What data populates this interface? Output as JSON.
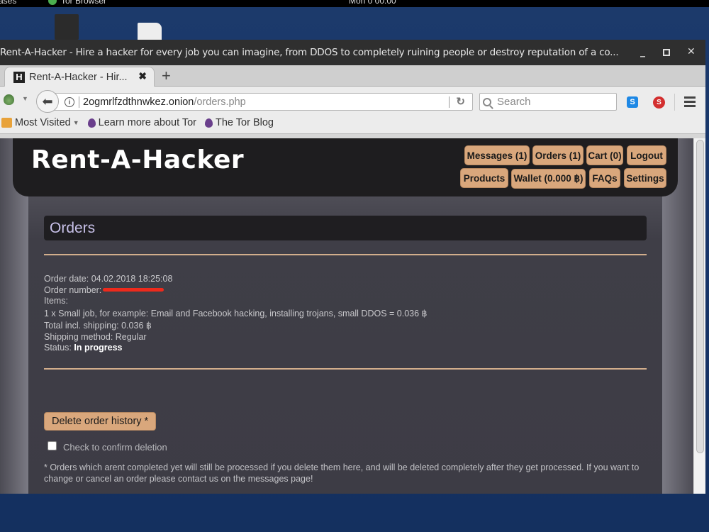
{
  "system_bar": {
    "left_text": "ases",
    "app_label": "Tor Browser",
    "clock": "Mon 0 00:00"
  },
  "window": {
    "title": "Rent-A-Hacker - Hire a hacker for every job you can imagine, from DDOS to completely ruining people or destroy reputation of a co...",
    "minimize_icon": "_",
    "close_icon": "✕"
  },
  "tabs": [
    {
      "favicon": "H",
      "label": "Rent-A-Hacker - Hir...",
      "close": "✖"
    }
  ],
  "new_tab": "+",
  "nav": {
    "back_icon": "⬅",
    "url_host": "2ogmrlfzdthnwkez.onion",
    "url_path": "/orders.php",
    "reload_icon": "↻",
    "search_placeholder": "Search",
    "ext_s_label": "S",
    "ext_noscript_label": "S"
  },
  "bookmarks": [
    {
      "label": "Most Visited",
      "type": "folder"
    },
    {
      "label": "Learn more about Tor",
      "type": "tor"
    },
    {
      "label": "The Tor Blog",
      "type": "tor"
    }
  ],
  "site": {
    "logo": "Rent-A-Hacker",
    "nav_buttons": [
      {
        "label": "Messages (1)"
      },
      {
        "label": "Orders (1)"
      },
      {
        "label": "Cart (0)"
      },
      {
        "label": "Logout"
      },
      {
        "label": "Products"
      },
      {
        "label": "Wallet (0.000 ฿)"
      },
      {
        "label": "FAQs"
      },
      {
        "label": "Settings"
      }
    ],
    "accent_color": "#d9a77c"
  },
  "orders_page": {
    "heading": "Orders",
    "order": {
      "date_label": "Order date:",
      "date_value": "04.02.2018 18:25:08",
      "number_label": "Order number:",
      "number_value": "[redacted]",
      "items_label": "Items:",
      "item_line": "1 x Small job, for example: Email and Facebook hacking, installing trojans, small DDOS = 0.036 ฿",
      "total_label": "Total incl. shipping:",
      "total_value": "0.036 ฿",
      "shipping_label": "Shipping method:",
      "shipping_value": "Regular",
      "status_label": "Status:",
      "status_value": "In progress"
    },
    "delete_button": "Delete order history *",
    "confirm_label": "Check to confirm deletion",
    "confirm_checked": false,
    "footnote": "* Orders which arent completed yet will still be processed if you delete them here, and will be deleted completely after they get processed. If you want to change or cancel an order please contact us on the messages page!"
  }
}
